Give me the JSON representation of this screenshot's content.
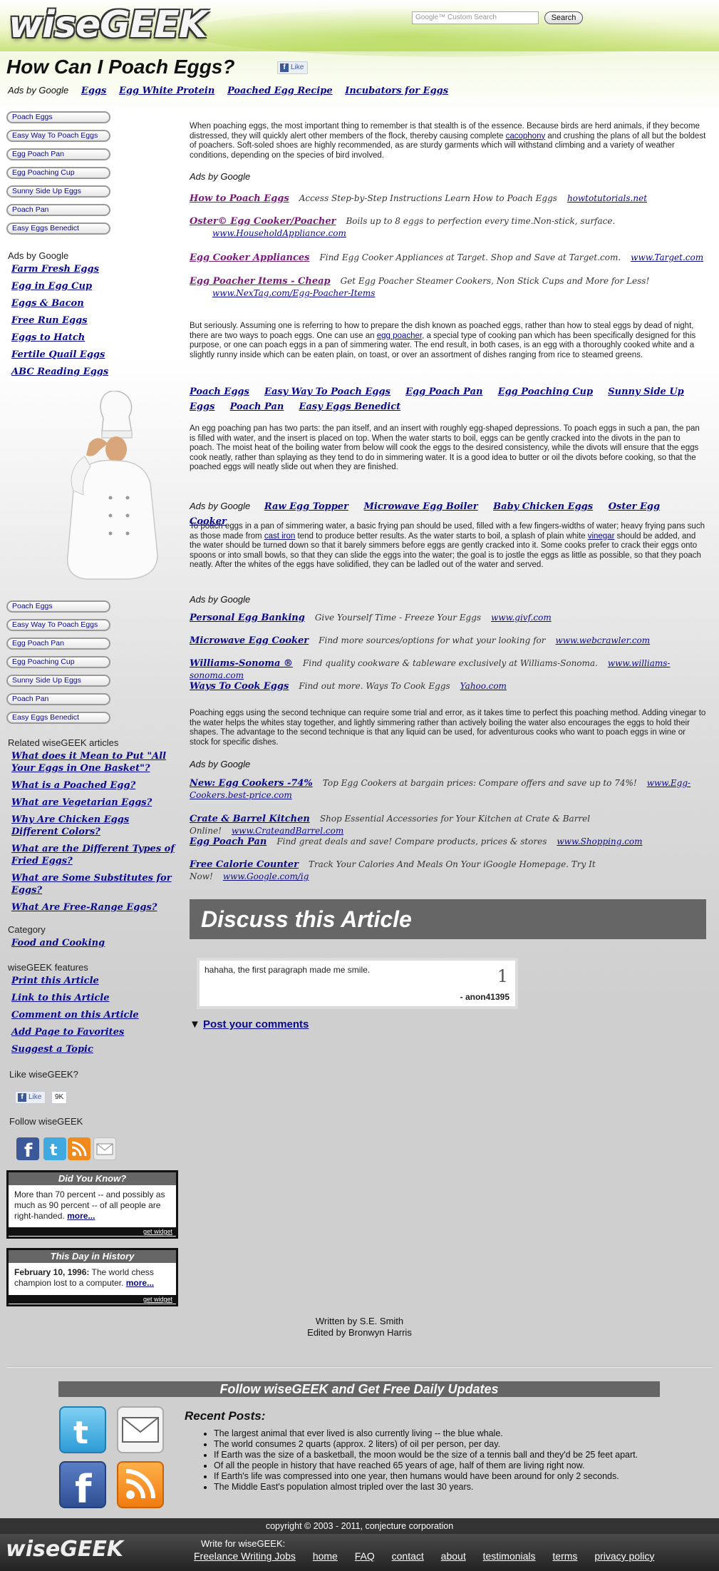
{
  "header": {
    "logo": "wiseGEEK",
    "search_placeholder": "Google™ Custom Search",
    "search_button": "Search"
  },
  "page": {
    "title": "How Can I Poach Eggs?",
    "like_label": "Like"
  },
  "top_ads": {
    "label": "Ads by Google",
    "links": [
      "Eggs",
      "Egg White Protein",
      "Poached Egg Recipe",
      "Incubators for Eggs"
    ]
  },
  "sidebar": {
    "pills_top": [
      "Poach Eggs",
      "Easy Way To Poach Eggs",
      "Egg Poach Pan",
      "Egg Poaching Cup",
      "Sunny Side Up Eggs",
      "Poach Pan",
      "Easy Eggs Benedict"
    ],
    "ads_label": "Ads by Google",
    "ads": [
      "Farm Fresh Eggs",
      "Egg in Egg Cup",
      "Eggs & Bacon",
      "Free Run Eggs",
      "Eggs to Hatch",
      "Fertile Quail Eggs",
      "ABC Reading Eggs"
    ],
    "pills_bottom": [
      "Poach Eggs",
      "Easy Way To Poach Eggs",
      "Egg Poach Pan",
      "Egg Poaching Cup",
      "Sunny Side Up Eggs",
      "Poach Pan",
      "Easy Eggs Benedict"
    ],
    "related_label": "Related wiseGEEK articles",
    "related": [
      "What does it Mean to Put \"All Your Eggs in One Basket\"?",
      "What is a Poached Egg?",
      "What are Vegetarian Eggs?",
      "Why Are Chicken Eggs Different Colors?",
      "What are the Different Types of Fried Eggs?",
      "What are Some Substitutes for Eggs?",
      "What Are Free-Range Eggs?"
    ],
    "category_label": "Category",
    "category": "Food and Cooking",
    "features_label": "wiseGEEK features",
    "features": [
      "Print this Article",
      "Link to this Article",
      "Comment on this Article",
      "Add Page to Favorites",
      "Suggest a Topic"
    ],
    "like_label": "Like wiseGEEK?",
    "like_button": "Like",
    "like_count": "9K",
    "follow_label": "Follow wiseGEEK",
    "did_you_know": {
      "title": "Did You Know?",
      "text": "More than 70 percent -- and possibly as much as 90 percent -- of all people are right-handed.",
      "more": "more...",
      "footer": "get widget"
    },
    "this_day": {
      "title": "This Day in History",
      "date": "February 10, 1996:",
      "text": "The world chess champion lost to a computer.",
      "more": "more...",
      "footer": "get widget"
    }
  },
  "article": {
    "p1_a": "When poaching eggs, the most important thing to remember is that stealth is of the essence. Because birds are herd animals, if they become distressed, they will quickly alert other members of the flock, thereby causing complete ",
    "p1_link": "cacophony",
    "p1_b": " and crushing the plans of all but the boldest of poachers. Soft-soled shoes are highly recommended, as are sturdy garments which will withstand climbing and a variety of weather conditions, depending on the species of bird involved.",
    "ads1_label": "Ads by Google",
    "ads1": [
      {
        "title": "How to Poach Eggs",
        "desc": "Access Step-by-Step Instructions Learn How to Poach Eggs",
        "url": "howtotutorials.net"
      },
      {
        "title": "Oster© Egg Cooker/Poacher",
        "desc": "Boils up to 8 eggs to perfection every time.Non-stick, surface.",
        "url": "www.HouseholdAppliance.com"
      },
      {
        "title": "Egg Cooker Appliances",
        "desc": "Find Egg Cooker Appliances at Target. Shop and Save at Target.com.",
        "url": "www.Target.com"
      },
      {
        "title": "Egg Poacher Items - Cheap",
        "desc": "Get Egg Poacher Steamer Cookers, Non Stick Cups and More for Less!",
        "url": "www.NexTag.com/Egg-Poacher-Items"
      }
    ],
    "p2_a": "But seriously. Assuming one is referring to how to prepare the dish known as poached eggs, rather than how to steal eggs by dead of night, there are two ways to poach eggs. One can use an ",
    "p2_link": "egg poacher",
    "p2_b": ", a special type of cooking pan which has been specifically designed for this purpose, or one can poach eggs in a pan of simmering water. The end result, in both cases, is an egg with a thoroughly cooked white and a slightly runny inside which can be eaten plain, on toast, or over an assortment of dishes ranging from rice to steamed greens.",
    "inline_links": [
      "Poach Eggs",
      "Easy Way To Poach Eggs",
      "Egg Poach Pan",
      "Egg Poaching Cup",
      "Sunny Side Up Eggs",
      "Poach Pan",
      "Easy Eggs Benedict"
    ],
    "p3": "An egg poaching pan has two parts: the pan itself, and an insert with roughly egg-shaped depressions. To poach eggs in such a pan, the pan is filled with water, and the insert is placed on top. When the water starts to boil, eggs can be gently cracked into the divots in the pan to poach. The moist heat of the boiling water from below will cook the eggs to the desired consistency, while the divots will ensure that the eggs cook neatly, rather than splaying as they tend to do in simmering water. It is a good idea to butter or oil the divots before cooking, so that the poached eggs will neatly slide out when they are finished.",
    "ads2_label": "Ads by Google",
    "ads2": [
      "Raw Egg Topper",
      "Microwave Egg Boiler",
      "Baby Chicken Eggs",
      "Oster Egg Cooker"
    ],
    "p4_a": "To poach eggs in a pan of simmering water, a basic frying pan should be used, filled with a few fingers-widths of water; heavy frying pans such as those made from ",
    "p4_link1": "cast iron",
    "p4_b": " tend to produce better results. As the water starts to boil, a splash of plain white ",
    "p4_link2": "vinegar",
    "p4_c": " should be added, and the water should be turned down so that it barely simmers before eggs are gently cracked into it. Some cooks prefer to crack their eggs onto spoons or into small bowls, so that they can slide the eggs into the water; the goal is to jostle the eggs as little as possible, so that they poach neatly. After the whites of the eggs have solidified, they can be ladled out of the water and served.",
    "ads3_label": "Ads by Google",
    "ads3": [
      {
        "title": "Personal Egg Banking",
        "desc": "Give Yourself Time - Freeze Your Eggs",
        "url": "www.givf.com"
      },
      {
        "title": "Microwave Egg Cooker",
        "desc": "Find more sources/options for what your looking for",
        "url": "www.webcrawler.com"
      },
      {
        "title": "Williams-Sonoma ®",
        "desc": "Find quality cookware & tableware exclusively at Williams-Sonoma.",
        "url": "www.williams-sonoma.com"
      },
      {
        "title": "Ways To Cook Eggs",
        "desc": "Find out more. Ways To Cook Eggs",
        "url": "Yahoo.com"
      }
    ],
    "p5": "Poaching eggs using the second technique can require some trial and error, as it takes time to perfect this poaching method. Adding vinegar to the water helps the whites stay together, and lightly simmering rather than actively boiling the water also encourages the eggs to hold their shapes. The advantage to the second technique is that any liquid can be used, for adventurous cooks who want to poach eggs in wine or stock for specific dishes.",
    "ads4_label": "Ads by Google",
    "ads4": [
      {
        "title": "New: Egg Cookers -74%",
        "desc": "Top Egg Cookers at bargain prices: Compare offers and save up to 74%!",
        "url": "www.Egg-Cookers.best-price.com"
      },
      {
        "title": "Crate & Barrel Kitchen",
        "desc": "Shop Essential Accessories for Your Kitchen at Crate & Barrel Online!",
        "url": "www.CrateandBarrel.com"
      },
      {
        "title": "Egg Poach Pan",
        "desc": "Find great deals and save! Compare products, prices & stores",
        "url": "www.Shopping.com"
      },
      {
        "title": "Free Calorie Counter",
        "desc": "Track Your Calories And Meals On Your iGoogle Homepage. Try It Now!",
        "url": "www.Google.com/ig"
      }
    ]
  },
  "discuss": {
    "title": "Discuss this Article",
    "comment_text": "hahaha, the first paragraph made me smile.",
    "comment_number": "1",
    "comment_author": "- anon41395",
    "post_arrow": "▼",
    "post_label": "Post your comments"
  },
  "credits": {
    "written": "Written by S.E. Smith",
    "edited": "Edited by Bronwyn Harris"
  },
  "follow_footer": {
    "title": "Follow wiseGEEK and Get Free Daily Updates",
    "recent_title": "Recent Posts:",
    "recent": [
      "The largest animal that ever lived is also currently living -- the blue whale.",
      "The world consumes 2 quarts (approx. 2 liters) of oil per person, per day.",
      "If Earth was the size of a basketball, the moon would be the size of a tennis ball and they'd be 25 feet apart.",
      "Of all the people in history that have reached 65 years of age, half of them are living right now.",
      "If Earth's life was compressed into one year, then humans would have been around for only 2 seconds.",
      "The Middle East's population almost tripled over the last 30 years."
    ]
  },
  "footer": {
    "copyright": "copyright © 2003 - 2011, conjecture corporation",
    "logo": "wiseGEEK",
    "write_for": "Write for wiseGEEK:",
    "nav": [
      "Freelance Writing Jobs",
      "home",
      "FAQ",
      "contact",
      "about",
      "testimonials",
      "terms",
      "privacy policy"
    ]
  },
  "colors": {
    "link": "#0a0a8c",
    "visited_link": "#7a1a7a",
    "header_green": "#c9e27a",
    "dark_bar": "#666666",
    "facebook": "#3b5998",
    "twitter": "#3fa9e0",
    "rss": "#f08a1c"
  }
}
